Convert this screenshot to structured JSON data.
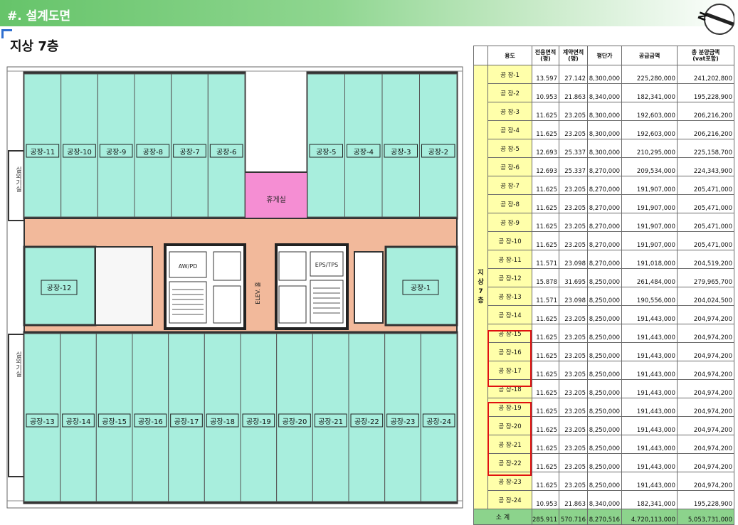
{
  "header": {
    "title": "#. 설계도면"
  },
  "floor_title": "지상 7층",
  "compass": {
    "label": "N"
  },
  "plan": {
    "top_units": [
      "공장-11",
      "공장-10",
      "공장-9",
      "공장-8",
      "공장-7",
      "공장-6",
      "공장-5",
      "공장-4",
      "공장-3",
      "공장-2"
    ],
    "bottom_units": [
      "공장-13",
      "공장-14",
      "공장-15",
      "공장-16",
      "공장-17",
      "공장-18",
      "공장-19",
      "공장-20",
      "공장-21",
      "공장-22",
      "공장-23",
      "공장-24"
    ],
    "left_unit": "공장-12",
    "right_unit": "공장-1",
    "lounge": "휴게실",
    "outdoor_label": "실외기실",
    "elev_hall": "ELEV. 홀",
    "aw_pd": "AW/PD",
    "eps_tps": "EPS/TPS"
  },
  "table": {
    "headers": {
      "use": "용도",
      "exclusive_area": [
        "전용면적",
        "(평)"
      ],
      "contract_area": [
        "계약면적",
        "(평)"
      ],
      "unit_price": "평단가",
      "supply_amount": "공급금액",
      "total_sale": [
        "총 분양금액",
        "(vat포함)"
      ]
    },
    "floor_label": [
      "지",
      "상",
      "7",
      "층"
    ],
    "rows": [
      {
        "use": "공 장-1",
        "exclusive": "13.597",
        "contract": "27.142",
        "price": "8,300,000",
        "supply": "225,280,000",
        "total": "241,202,800"
      },
      {
        "use": "공 장-2",
        "exclusive": "10.953",
        "contract": "21.863",
        "price": "8,340,000",
        "supply": "182,341,000",
        "total": "195,228,900"
      },
      {
        "use": "공 장-3",
        "exclusive": "11.625",
        "contract": "23.205",
        "price": "8,300,000",
        "supply": "192,603,000",
        "total": "206,216,200"
      },
      {
        "use": "공 장-4",
        "exclusive": "11.625",
        "contract": "23.205",
        "price": "8,300,000",
        "supply": "192,603,000",
        "total": "206,216,200"
      },
      {
        "use": "공 장-5",
        "exclusive": "12.693",
        "contract": "25.337",
        "price": "8,300,000",
        "supply": "210,295,000",
        "total": "225,158,700"
      },
      {
        "use": "공 장-6",
        "exclusive": "12.693",
        "contract": "25.337",
        "price": "8,270,000",
        "supply": "209,534,000",
        "total": "224,343,900"
      },
      {
        "use": "공 장-7",
        "exclusive": "11.625",
        "contract": "23.205",
        "price": "8,270,000",
        "supply": "191,907,000",
        "total": "205,471,000"
      },
      {
        "use": "공 장-8",
        "exclusive": "11.625",
        "contract": "23.205",
        "price": "8,270,000",
        "supply": "191,907,000",
        "total": "205,471,000"
      },
      {
        "use": "공 장-9",
        "exclusive": "11.625",
        "contract": "23.205",
        "price": "8,270,000",
        "supply": "191,907,000",
        "total": "205,471,000"
      },
      {
        "use": "공 장-10",
        "exclusive": "11.625",
        "contract": "23.205",
        "price": "8,270,000",
        "supply": "191,907,000",
        "total": "205,471,000"
      },
      {
        "use": "공 장-11",
        "exclusive": "11.571",
        "contract": "23.098",
        "price": "8,270,000",
        "supply": "191,018,000",
        "total": "204,519,200"
      },
      {
        "use": "공 장-12",
        "exclusive": "15.878",
        "contract": "31.695",
        "price": "8,250,000",
        "supply": "261,484,000",
        "total": "279,965,700"
      },
      {
        "use": "공 장-13",
        "exclusive": "11.571",
        "contract": "23.098",
        "price": "8,250,000",
        "supply": "190,556,000",
        "total": "204,024,500"
      },
      {
        "use": "공 장-14",
        "exclusive": "11.625",
        "contract": "23.205",
        "price": "8,250,000",
        "supply": "191,443,000",
        "total": "204,974,200"
      },
      {
        "use": "공 장-15",
        "exclusive": "11.625",
        "contract": "23.205",
        "price": "8,250,000",
        "supply": "191,443,000",
        "total": "204,974,200"
      },
      {
        "use": "공 장-16",
        "exclusive": "11.625",
        "contract": "23.205",
        "price": "8,250,000",
        "supply": "191,443,000",
        "total": "204,974,200"
      },
      {
        "use": "공 장-17",
        "exclusive": "11.625",
        "contract": "23.205",
        "price": "8,250,000",
        "supply": "191,443,000",
        "total": "204,974,200"
      },
      {
        "use": "공 장-18",
        "exclusive": "11.625",
        "contract": "23.205",
        "price": "8,250,000",
        "supply": "191,443,000",
        "total": "204,974,200"
      },
      {
        "use": "공 장-19",
        "exclusive": "11.625",
        "contract": "23.205",
        "price": "8,250,000",
        "supply": "191,443,000",
        "total": "204,974,200"
      },
      {
        "use": "공 장-20",
        "exclusive": "11.625",
        "contract": "23.205",
        "price": "8,250,000",
        "supply": "191,443,000",
        "total": "204,974,200"
      },
      {
        "use": "공 장-21",
        "exclusive": "11.625",
        "contract": "23.205",
        "price": "8,250,000",
        "supply": "191,443,000",
        "total": "204,974,200"
      },
      {
        "use": "공 장-22",
        "exclusive": "11.625",
        "contract": "23.205",
        "price": "8,250,000",
        "supply": "191,443,000",
        "total": "204,974,200"
      },
      {
        "use": "공 장-23",
        "exclusive": "11.625",
        "contract": "23.205",
        "price": "8,250,000",
        "supply": "191,443,000",
        "total": "204,974,200"
      },
      {
        "use": "공 장-24",
        "exclusive": "10.953",
        "contract": "21.863",
        "price": "8,340,000",
        "supply": "182,341,000",
        "total": "195,228,900"
      }
    ],
    "total_row": {
      "label": "소      계",
      "exclusive": "285.911",
      "contract": "570.716",
      "price": "8,270,516",
      "supply": "4,720,113,000",
      "total": "5,053,731,000"
    }
  },
  "colors": {
    "header_green": "#66c46a",
    "unit_fill": "#a8eedd",
    "corridor_fill": "#f2b99b",
    "lounge_fill": "#f58ed3",
    "table_use_fill": "#ffffaa",
    "table_total_fill": "#8cd38c",
    "highlight_red": "#e01010"
  }
}
